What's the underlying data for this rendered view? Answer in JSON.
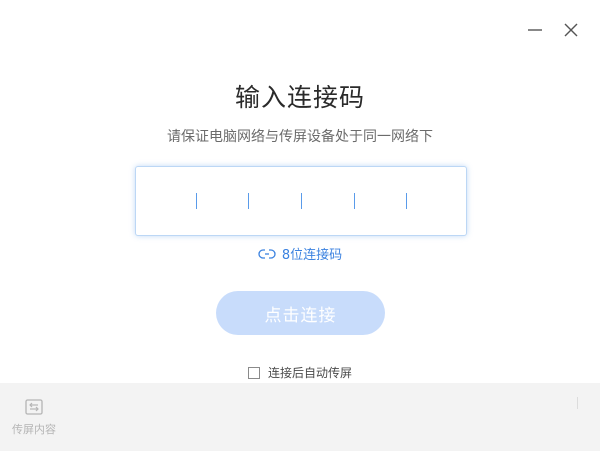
{
  "window": {
    "minimize_icon": "minimize-icon",
    "close_icon": "close-icon"
  },
  "main": {
    "title": "输入连接码",
    "subtitle": "请保证电脑网络与传屏设备处于同一网络下",
    "code_input": {
      "slots": 5,
      "value": ""
    },
    "switch_link_label": "8位连接码",
    "connect_button_label": "点击连接",
    "auto_cast": {
      "label": "连接后自动传屏",
      "checked": false
    }
  },
  "bottom_bar": {
    "cast_content_label": "传屏内容",
    "cast_content_icon": "screen-cast-icon"
  },
  "colors": {
    "accent": "#3b82e0",
    "button_disabled": "#c8dcfb",
    "input_border": "#bcd7f5",
    "bottom_bar": "#f3f3f3"
  }
}
